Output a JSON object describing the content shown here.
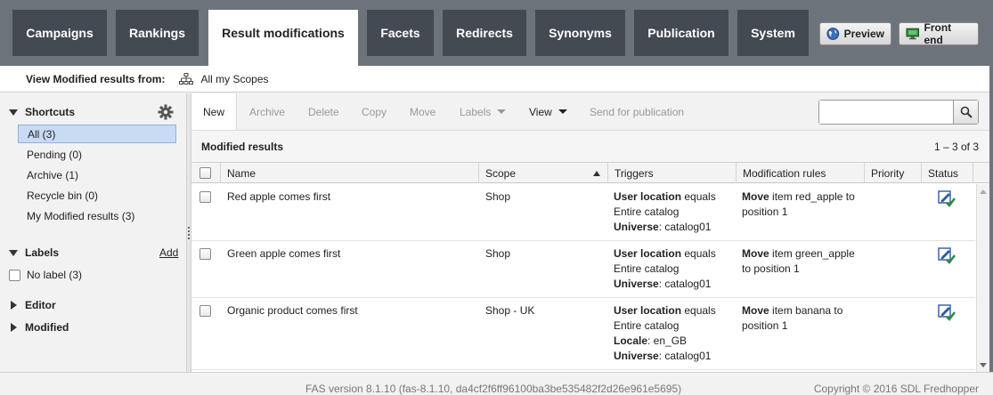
{
  "nav": {
    "tabs": [
      {
        "label": "Campaigns"
      },
      {
        "label": "Rankings"
      },
      {
        "label": "Result modifications"
      },
      {
        "label": "Facets"
      },
      {
        "label": "Redirects"
      },
      {
        "label": "Synonyms"
      },
      {
        "label": "Publication"
      },
      {
        "label": "System"
      }
    ],
    "active_tab": "Result modifications",
    "preview_label": "Preview",
    "frontend_label": "Front end"
  },
  "scopebar": {
    "label": "View Modified results from:",
    "scope": "All my Scopes"
  },
  "left": {
    "shortcuts_title": "Shortcuts",
    "shortcuts": [
      {
        "label": "All (3)",
        "selected": true
      },
      {
        "label": "Pending (0)"
      },
      {
        "label": "Archive (1)"
      },
      {
        "label": "Recycle bin (0)"
      },
      {
        "label": "My Modified results (3)"
      }
    ],
    "labels_title": "Labels",
    "labels_add": "Add",
    "no_label": "No label (3)",
    "editor_title": "Editor",
    "modified_title": "Modified"
  },
  "toolbar": {
    "new": "New",
    "archive": "Archive",
    "delete": "Delete",
    "copy": "Copy",
    "move": "Move",
    "labels": "Labels",
    "view": "View",
    "send": "Send for publication",
    "search_value": ""
  },
  "results": {
    "title": "Modified results",
    "count": "1 – 3 of 3",
    "columns": [
      "Name",
      "Scope",
      "Triggers",
      "Modification rules",
      "Priority",
      "Status"
    ],
    "rows": [
      {
        "name": "Red apple comes first",
        "scope": "Shop",
        "trigger_lines": [
          {
            "bold": "User location",
            "text": " equals"
          },
          {
            "bold": "",
            "text": "Entire catalog"
          },
          {
            "bold": "Universe",
            "text": ": catalog01"
          }
        ],
        "rule_lines": [
          {
            "bold": "Move",
            "text": " item red_apple to"
          },
          {
            "bold": "",
            "text": "position 1"
          }
        ]
      },
      {
        "name": "Green apple comes first",
        "scope": "Shop",
        "trigger_lines": [
          {
            "bold": "User location",
            "text": " equals"
          },
          {
            "bold": "",
            "text": "Entire catalog"
          },
          {
            "bold": "Universe",
            "text": ": catalog01"
          }
        ],
        "rule_lines": [
          {
            "bold": "Move",
            "text": " item green_apple"
          },
          {
            "bold": "",
            "text": "to position 1"
          }
        ]
      },
      {
        "name": "Organic product comes first",
        "scope": "Shop - UK",
        "trigger_lines": [
          {
            "bold": "User location",
            "text": " equals"
          },
          {
            "bold": "",
            "text": "Entire catalog"
          },
          {
            "bold": "Locale",
            "text": ": en_GB"
          },
          {
            "bold": "Universe",
            "text": ": catalog01"
          }
        ],
        "rule_lines": [
          {
            "bold": "Move",
            "text": " item banana to"
          },
          {
            "bold": "",
            "text": "position 1"
          }
        ]
      }
    ]
  },
  "footer": {
    "version": "FAS version 8.1.10 (fas-8.1.10, da4cf2f6ff96100ba3be535482f2d26e961e5695)",
    "copyright": "Copyright © 2016 SDL Fredhopper"
  },
  "colors": {
    "nav_bg": "#6d737b",
    "tab_bg": "#444a52",
    "selected_bg": "#c9daf3",
    "status_green": "#2e8b3a",
    "status_blue": "#2a5ba8"
  }
}
